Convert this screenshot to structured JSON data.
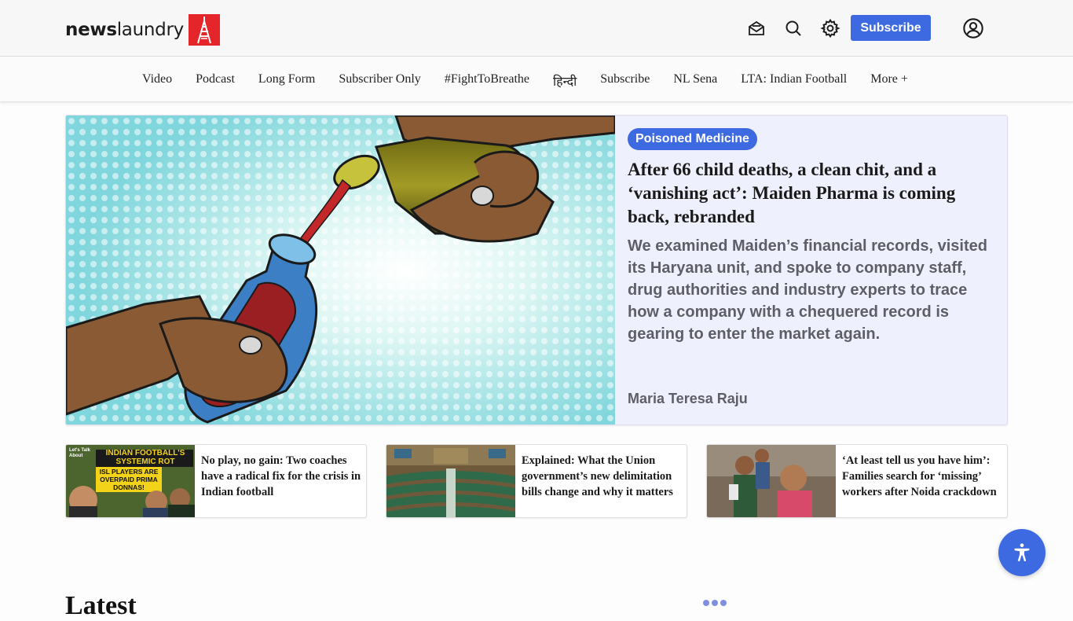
{
  "header": {
    "logo_text_bold": "news",
    "logo_text_light": "laundry",
    "subscribe_label": "Subscribe",
    "icons": [
      "newsletter-envelope-icon",
      "search-icon",
      "gear-icon",
      "account-icon"
    ]
  },
  "nav": {
    "items": [
      {
        "label": "Video"
      },
      {
        "label": "Podcast"
      },
      {
        "label": "Long Form"
      },
      {
        "label": "Subscriber Only"
      },
      {
        "label": "#FightToBreathe"
      },
      {
        "label": "हिन्दी"
      },
      {
        "label": "Subscribe"
      },
      {
        "label": "NL Sena"
      },
      {
        "label": "LTA: Indian Football"
      },
      {
        "label": "More +"
      }
    ]
  },
  "hero": {
    "tag": "Poisoned Medicine",
    "title": "After 66 child deaths, a clean chit, and a ‘vanishing act’: Maiden Pharma is coming back, rebranded",
    "description": "We examined Maiden’s financial records, visited its Haryana unit, and spoke to company staff, drug authorities and industry experts to trace how a company with a chequered record is gearing to enter the market again.",
    "author": "Maria Teresa Raju"
  },
  "cards": [
    {
      "title": "No play, no gain: Two coaches have a radical fix for the crisis in Indian football",
      "thumb_text_1": "INDIAN FOOTBALL'S SYSTEMIC ROT",
      "thumb_text_2": "ISL PLAYERS ARE OVERPAID PRIMA DONNAS!",
      "thumb_corner": "Let's Talk About"
    },
    {
      "title": "Explained: What the Union government’s new delimitation bills change and why it matters"
    },
    {
      "title": "‘At least tell us you have him’: Families search for ‘missing’ workers after Noida crackdown"
    }
  ],
  "latest": {
    "heading": "Latest"
  },
  "colors": {
    "accent": "#3d6ae0",
    "brand_red": "#e4262a"
  }
}
